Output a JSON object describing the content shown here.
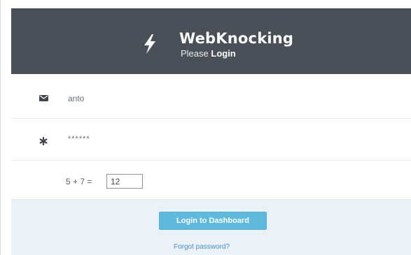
{
  "header": {
    "icon": "lightning-bolt-icon",
    "title": "WebKnocking",
    "subtitle_prefix": "Please",
    "subtitle_bold": "Login"
  },
  "form": {
    "username": {
      "icon": "envelope-icon",
      "value": "anto"
    },
    "password": {
      "icon": "asterisk-icon",
      "value": "******"
    },
    "captcha": {
      "question": "5 + 7 =",
      "answer": "12"
    }
  },
  "footer": {
    "login_button_label": "Login to Dashboard",
    "forgot_password_label": "Forgot password?"
  },
  "colors": {
    "header_background": "#4a5058",
    "button_background": "#5fb9dd",
    "footer_background": "#eaf2f8",
    "link": "#4a8ec5"
  }
}
